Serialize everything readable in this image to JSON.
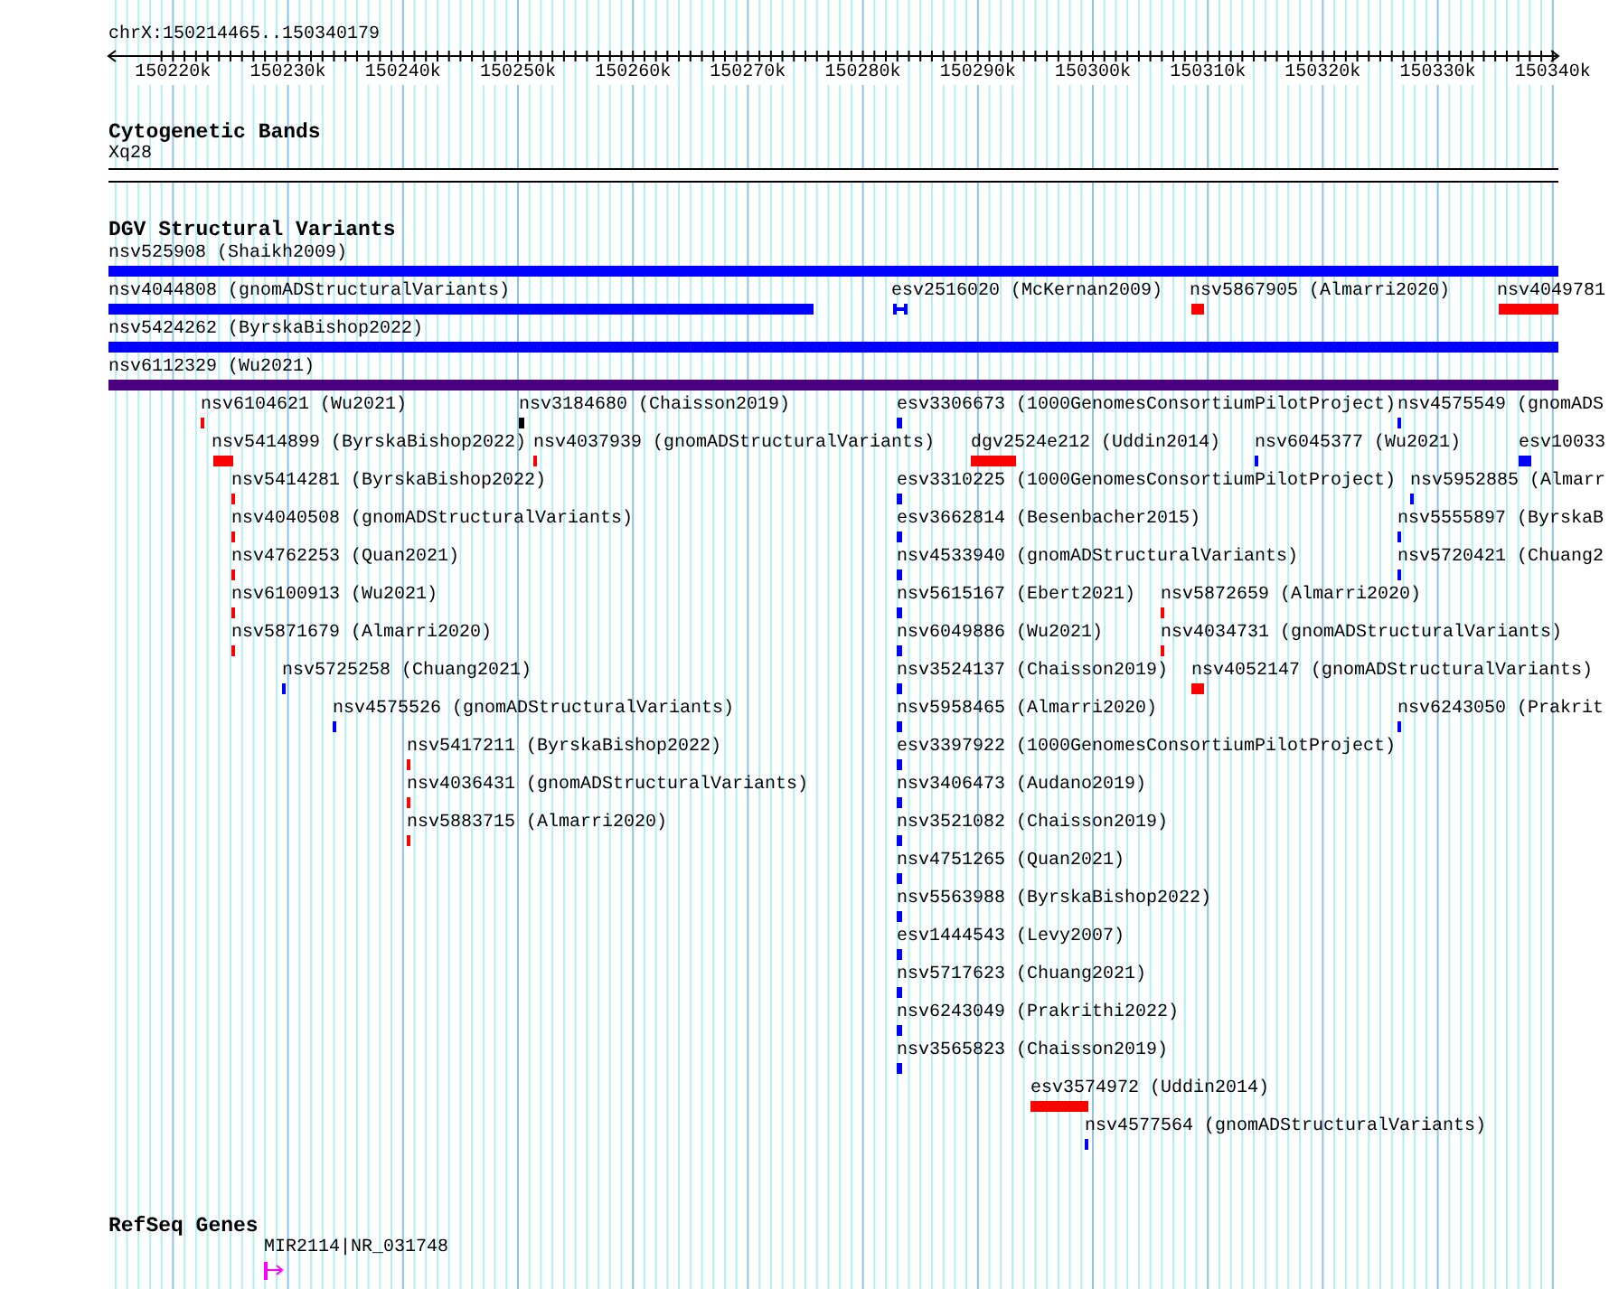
{
  "ruler": {
    "location": "chrX:150214465..150340179",
    "ticks": [
      "150220k",
      "150230k",
      "150240k",
      "150250k",
      "150260k",
      "150270k",
      "150280k",
      "150290k",
      "150300k",
      "150310k",
      "150320k",
      "150330k",
      "150340k"
    ]
  },
  "tracks": [
    {
      "kind": "cytobands",
      "title": "Cytogenetic Bands",
      "bands": [
        {
          "label": "Xq28"
        }
      ]
    },
    {
      "kind": "variants",
      "title": "DGV Structural Variants",
      "features": [
        {
          "label": "nsv525908 (Shaikh2009)",
          "color": "#0000ff"
        },
        {
          "label": "nsv4044808 (gnomADStructuralVariants)",
          "color": "#0000ff"
        },
        {
          "label": "esv2516020 (McKernan2009)",
          "color": "#0000ff"
        },
        {
          "label": "nsv5867905 (Almarri2020)",
          "color": "#ff0000"
        },
        {
          "label": "nsv4049781",
          "color": "#ff0000"
        },
        {
          "label": "nsv5424262 (ByrskaBishop2022)",
          "color": "#0000ff"
        },
        {
          "label": "nsv6112329 (Wu2021)",
          "color": "#4b0082"
        },
        {
          "label": "nsv6104621 (Wu2021)",
          "color": "#ff0000"
        },
        {
          "label": "nsv3184680 (Chaisson2019)",
          "color": "#000000"
        },
        {
          "label": "esv3306673 (1000GenomesConsortiumPilotProject)",
          "color": "#0000ff"
        },
        {
          "label": "nsv4575549 (gnomADS",
          "color": "#0000ff"
        },
        {
          "label": "nsv5414899 (ByrskaBishop2022)",
          "color": "#ff0000"
        },
        {
          "label": "nsv4037939 (gnomADStructuralVariants)",
          "color": "#ff0000"
        },
        {
          "label": "dgv2524e212 (Uddin2014)",
          "color": "#ff0000"
        },
        {
          "label": "nsv6045377 (Wu2021)",
          "color": "#0000ff"
        },
        {
          "label": "esv10033",
          "color": "#0000ff"
        },
        {
          "label": "nsv5414281 (ByrskaBishop2022)",
          "color": "#ff0000"
        },
        {
          "label": "esv3310225 (1000GenomesConsortiumPilotProject)",
          "color": "#0000ff"
        },
        {
          "label": "nsv5952885 (Almarr",
          "color": "#0000ff"
        },
        {
          "label": "nsv4040508 (gnomADStructuralVariants)",
          "color": "#ff0000"
        },
        {
          "label": "esv3662814 (Besenbacher2015)",
          "color": "#0000ff"
        },
        {
          "label": "nsv5555897 (ByrskaB",
          "color": "#0000ff"
        },
        {
          "label": "nsv4762253 (Quan2021)",
          "color": "#ff0000"
        },
        {
          "label": "nsv4533940 (gnomADStructuralVariants)",
          "color": "#0000ff"
        },
        {
          "label": "nsv5720421 (Chuang2",
          "color": "#0000ff"
        },
        {
          "label": "nsv6100913 (Wu2021)",
          "color": "#ff0000"
        },
        {
          "label": "nsv5615167 (Ebert2021)",
          "color": "#0000ff"
        },
        {
          "label": "nsv5872659 (Almarri2020)",
          "color": "#ff0000"
        },
        {
          "label": "nsv5871679 (Almarri2020)",
          "color": "#ff0000"
        },
        {
          "label": "nsv6049886 (Wu2021)",
          "color": "#0000ff"
        },
        {
          "label": "nsv4034731 (gnomADStructuralVariants)",
          "color": "#ff0000"
        },
        {
          "label": "nsv5725258 (Chuang2021)",
          "color": "#0000ff"
        },
        {
          "label": "nsv3524137 (Chaisson2019)",
          "color": "#0000ff"
        },
        {
          "label": "nsv4052147 (gnomADStructuralVariants)",
          "color": "#ff0000"
        },
        {
          "label": "nsv4575526 (gnomADStructuralVariants)",
          "color": "#0000ff"
        },
        {
          "label": "nsv5958465 (Almarri2020)",
          "color": "#0000ff"
        },
        {
          "label": "nsv6243050 (Prakrit",
          "color": "#0000ff"
        },
        {
          "label": "nsv5417211 (ByrskaBishop2022)",
          "color": "#ff0000"
        },
        {
          "label": "esv3397922 (1000GenomesConsortiumPilotProject)",
          "color": "#0000ff"
        },
        {
          "label": "nsv4036431 (gnomADStructuralVariants)",
          "color": "#ff0000"
        },
        {
          "label": "nsv3406473 (Audano2019)",
          "color": "#0000ff"
        },
        {
          "label": "nsv5883715 (Almarri2020)",
          "color": "#ff0000"
        },
        {
          "label": "nsv3521082 (Chaisson2019)",
          "color": "#0000ff"
        },
        {
          "label": "nsv4751265 (Quan2021)",
          "color": "#0000ff"
        },
        {
          "label": "nsv5563988 (ByrskaBishop2022)",
          "color": "#0000ff"
        },
        {
          "label": "esv1444543 (Levy2007)",
          "color": "#0000ff"
        },
        {
          "label": "nsv5717623 (Chuang2021)",
          "color": "#0000ff"
        },
        {
          "label": "nsv6243049 (Prakrithi2022)",
          "color": "#0000ff"
        },
        {
          "label": "nsv3565823 (Chaisson2019)",
          "color": "#0000ff"
        },
        {
          "label": "esv3574972 (Uddin2014)",
          "color": "#ff0000"
        },
        {
          "label": "nsv4577564 (gnomADStructuralVariants)",
          "color": "#0000ff"
        }
      ]
    },
    {
      "kind": "genes",
      "title": "RefSeq Genes",
      "genes": [
        {
          "label": "MIR2114|NR_031748"
        }
      ]
    }
  ]
}
